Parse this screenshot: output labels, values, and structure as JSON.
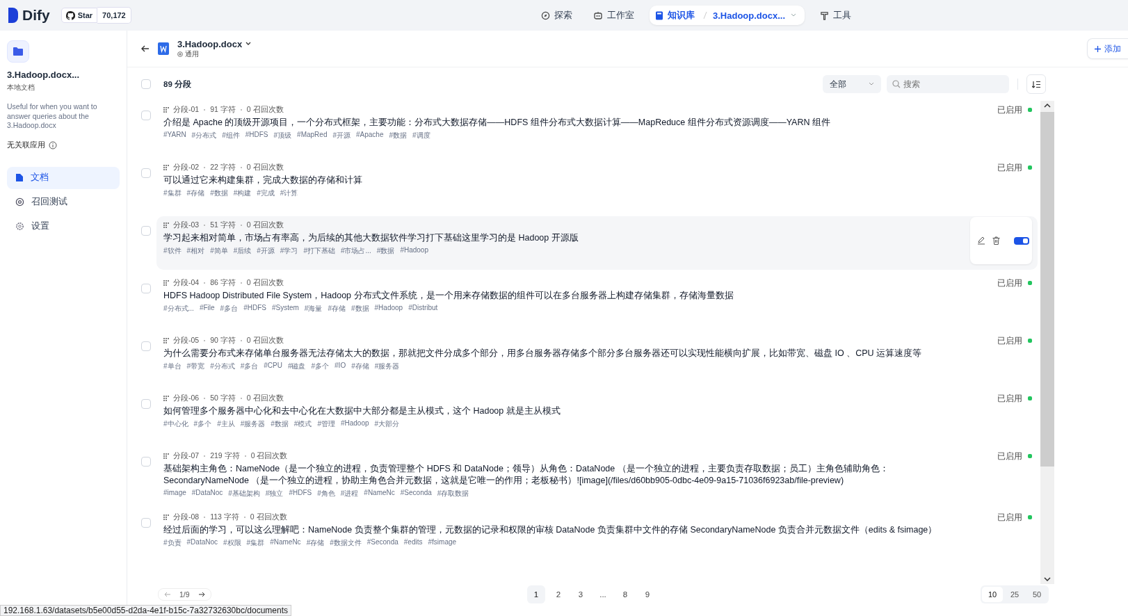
{
  "topbar": {
    "logo": "Dify",
    "star_label": "Star",
    "star_count": "70,172",
    "nav": [
      {
        "label": "探索",
        "selected": false,
        "kind": "explore"
      },
      {
        "label": "工作室",
        "selected": false,
        "kind": "studio"
      },
      {
        "label": "知识库",
        "selected": true,
        "kind": "knowledge",
        "crumb": "3.Hadoop.docx..."
      },
      {
        "label": "工具",
        "selected": false,
        "kind": "tools"
      }
    ]
  },
  "sidebar": {
    "name": "3.Hadoop.docx...",
    "type": "本地文档",
    "description": "Useful for when you want to answer queries about the 3.Hadoop.docx",
    "linked": "无关联应用",
    "items": [
      {
        "label": "文档",
        "selected": true,
        "kind": "doc"
      },
      {
        "label": "召回测试",
        "selected": false,
        "kind": "target"
      },
      {
        "label": "设置",
        "selected": false,
        "kind": "gear"
      }
    ]
  },
  "header": {
    "title": "3.Hadoop.docx",
    "subtitle": "通用",
    "add_button": "添加"
  },
  "toolbar": {
    "checked": false,
    "count": "89 分段",
    "filter": "全部",
    "search_placeholder": "搜索"
  },
  "segments": [
    {
      "checked": false,
      "id": "分段-01",
      "chars": "91 字符",
      "hits": "0 召回次数",
      "text": "介绍是 Apache 的顶级开源项目，一个分布式框架，主要功能：分布式大数据存储——HDFS 组件分布式大数据计算——MapReduce 组件分布式资源调度——YARN 组件",
      "tags": [
        "#YARN",
        "#分布式",
        "#组件",
        "#HDFS",
        "#顶级",
        "#MapRed",
        "#开源",
        "#Apache",
        "#数据",
        "#调度"
      ],
      "status": "已启用",
      "enabled": true,
      "hovered": false
    },
    {
      "checked": false,
      "id": "分段-02",
      "chars": "22 字符",
      "hits": "0 召回次数",
      "text": "可以通过它来构建集群，完成大数据的存储和计算",
      "tags": [
        "#集群",
        "#存储",
        "#数据",
        "#构建",
        "#完成",
        "#计算"
      ],
      "status": "已启用",
      "enabled": true,
      "hovered": false
    },
    {
      "checked": false,
      "id": "分段-03",
      "chars": "51 字符",
      "hits": "0 召回次数",
      "text": "学习起来相对简单，市场占有率高，为后续的其他大数据软件学习打下基础这里学习的是 Hadoop 开源版",
      "tags": [
        "#软件",
        "#相对",
        "#简单",
        "#后续",
        "#开源",
        "#学习",
        "#打下基础",
        "#市场占...",
        "#数据",
        "#Hadoop"
      ],
      "enabled": true,
      "hovered": true
    },
    {
      "checked": false,
      "id": "分段-04",
      "chars": "86 字符",
      "hits": "0 召回次数",
      "text": "HDFS Hadoop Distributed File System，Hadoop 分布式文件系统，是一个用来存储数据的组件可以在多台服务器上构建存储集群，存储海量数据",
      "tags": [
        "#分布式...",
        "#File",
        "#多台",
        "#HDFS",
        "#System",
        "#海量",
        "#存储",
        "#数据",
        "#Hadoop",
        "#Distribut"
      ],
      "status": "已启用",
      "enabled": true,
      "hovered": false
    },
    {
      "checked": false,
      "id": "分段-05",
      "chars": "90 字符",
      "hits": "0 召回次数",
      "text": "为什么需要分布式来存储单台服务器无法存储太大的数据，那就把文件分成多个部分，用多台服务器存储多个部分多台服务器还可以实现性能横向扩展，比如带宽、磁盘 IO 、CPU 运算速度等",
      "tags": [
        "#单台",
        "#带宽",
        "#分布式",
        "#多台",
        "#CPU",
        "#磁盘",
        "#多个",
        "#IO",
        "#存储",
        "#服务器"
      ],
      "status": "已启用",
      "enabled": true,
      "hovered": false
    },
    {
      "checked": false,
      "id": "分段-06",
      "chars": "50 字符",
      "hits": "0 召回次数",
      "text": "如何管理多个服务器中心化和去中心化在大数据中大部分都是主从模式，这个 Hadoop 就是主从模式",
      "tags": [
        "#中心化",
        "#多个",
        "#主从",
        "#服务器",
        "#数据",
        "#模式",
        "#管理",
        "#Hadoop",
        "#大部分"
      ],
      "status": "已启用",
      "enabled": true,
      "hovered": false
    },
    {
      "checked": false,
      "id": "分段-07",
      "chars": "219 字符",
      "hits": "0 召回次数",
      "text": "基础架构主角色：NameNode（是一个独立的进程，负责管理整个 HDFS 和 DataNode；领导）从角色：DataNode （是一个独立的进程，主要负责存取数据；员工）主角色辅助角色：SecondaryNameNode （是一个独立的进程，协助主角色合并元数据，这就是它唯一的作用；老板秘书）![image](/files/d60bb905-0dbc-4e09-9a15-71036f6923ab/file-preview)",
      "tags": [
        "#image",
        "#DataNoc",
        "#基础架构",
        "#独立",
        "#HDFS",
        "#角色",
        "#进程",
        "#NameNc",
        "#Seconda",
        "#存取数据"
      ],
      "status": "已启用",
      "enabled": true,
      "hovered": false
    },
    {
      "checked": false,
      "id": "分段-08",
      "chars": "113 字符",
      "hits": "0 召回次数",
      "text": "经过后面的学习，可以这么理解吧：NameNode 负责整个集群的管理，元数据的记录和权限的审核 DataNode 负责集群中文件的存储 SecondaryNameNode 负责合并元数据文件（edits & fsimage）",
      "tags": [
        "#负责",
        "#DataNoc",
        "#权限",
        "#集群",
        "#NameNc",
        "#存储",
        "#数据文件",
        "#Seconda",
        "#edits",
        "#fsimage"
      ],
      "status": "已启用",
      "enabled": true,
      "hovered": false
    }
  ],
  "pager": {
    "position": "1/9"
  },
  "pagination": {
    "pages": [
      {
        "label": "1",
        "selected": true
      },
      {
        "label": "2",
        "selected": false
      },
      {
        "label": "3",
        "selected": false
      },
      {
        "label": "...",
        "selected": false
      },
      {
        "label": "8",
        "selected": false
      },
      {
        "label": "9",
        "selected": false
      }
    ],
    "sizes": [
      {
        "label": "10",
        "selected": true
      },
      {
        "label": "25",
        "selected": false
      },
      {
        "label": "50",
        "selected": false
      }
    ]
  },
  "status_url": "192.168.1.63/datasets/b5e00d55-d2da-4e1f-b15c-7a32732630bc/documents"
}
